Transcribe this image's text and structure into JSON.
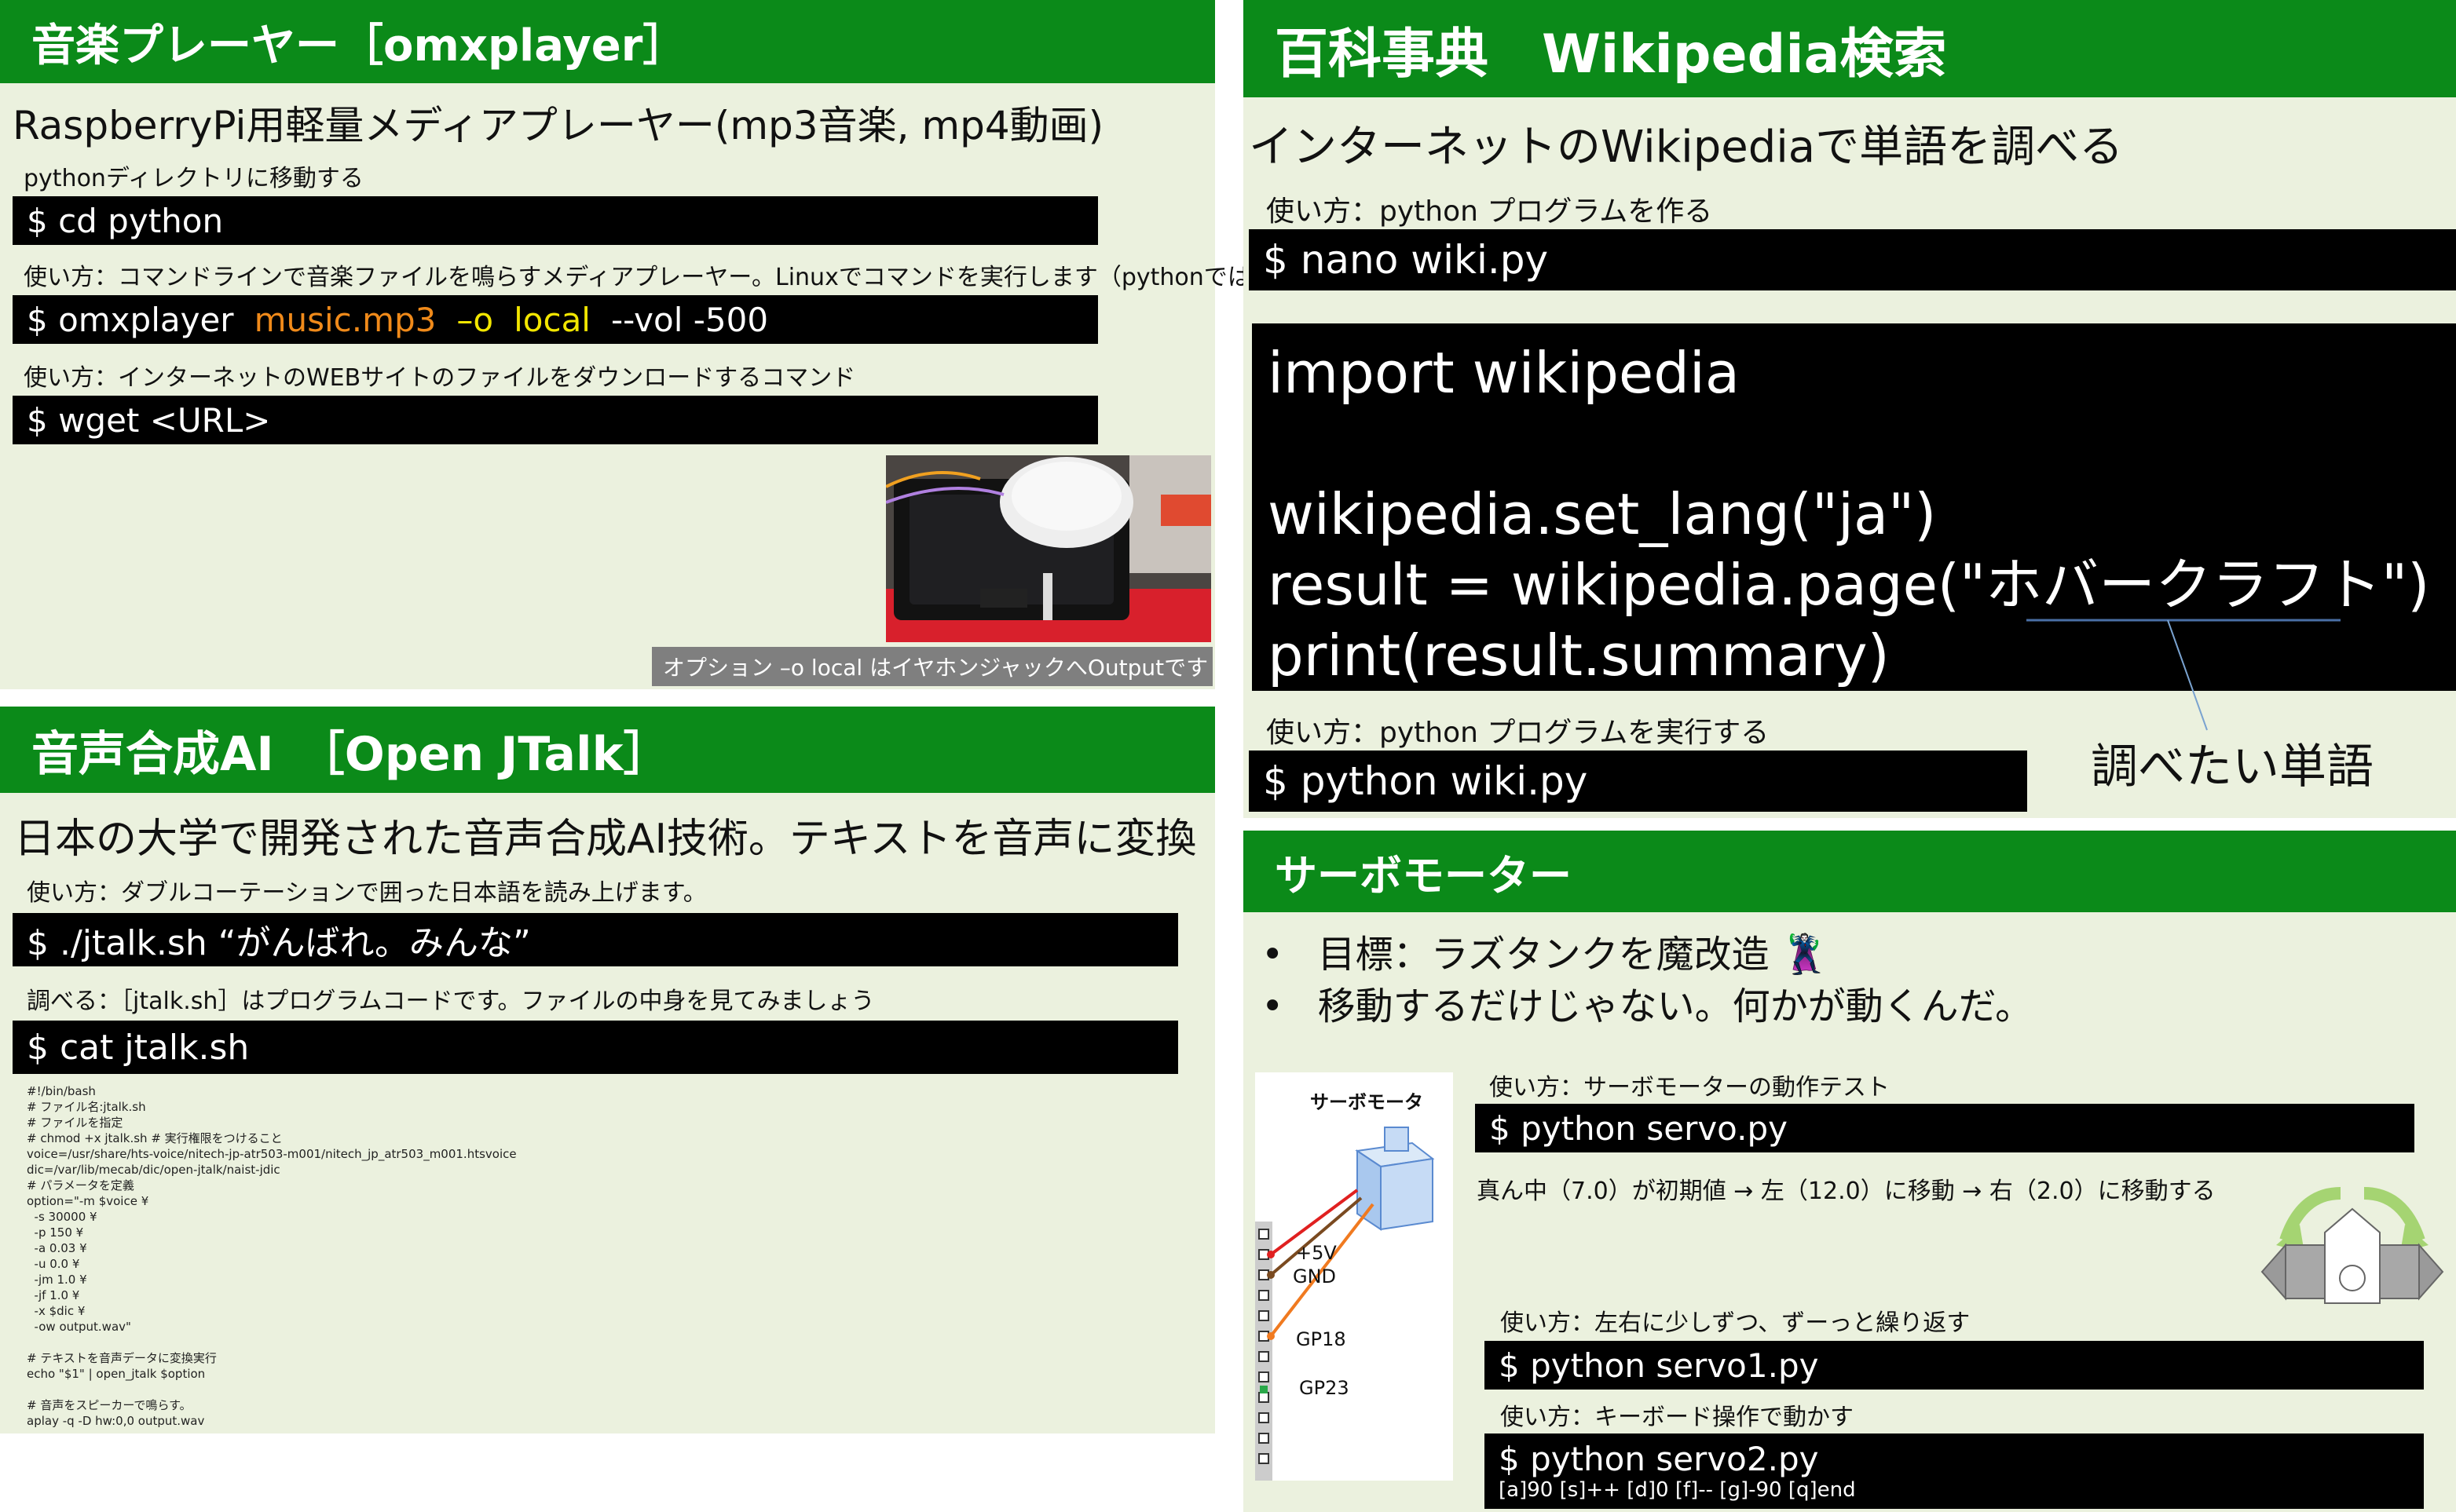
{
  "omx": {
    "title": "音楽プレーヤー［omxplayer］",
    "desc": "RaspberryPi用軽量メディアプレーヤー(mp3音楽, mp4動画)",
    "note1": "pythonディレクトリに移動する",
    "cmd1": "$ cd python",
    "note2": "使い方：コマンドラインで音楽ファイルを鳴らすメディアプレーヤー。Linuxでコマンドを実行します（pythonではない）",
    "cmd2_prefix": "$ omxplayer",
    "cmd2_file": "music.mp3",
    "cmd2_opt": "–o",
    "cmd2_local": "local",
    "cmd2_rest": "--vol  -500",
    "note3": "使い方：インターネットのWEBサイトのファイルをダウンロードするコマンド",
    "cmd3": "$ wget <URL>",
    "option_caption": "オプション –o  local  はイヤホンジャックへOutputです"
  },
  "jtalk": {
    "title": "音声合成AI　［Open JTalk］",
    "desc": "日本の大学で開発された音声合成AI技術。テキストを音声に変換",
    "note1": "使い方：ダブルコーテーションで囲った日本語を読み上げます。",
    "cmd1": "$ ./jtalk.sh  “がんばれ。みんな”",
    "note2": "調べる：［jtalk.sh］はプログラムコードです。ファイルの中身を見てみましょう",
    "cmd2": "$ cat  jtalk.sh",
    "script": "#!/bin/bash\n# ファイル名:jtalk.sh\n# ファイルを指定\n# chmod +x jtalk.sh # 実行権限をつけること\nvoice=/usr/share/hts-voice/nitech-jp-atr503-m001/nitech_jp_atr503_m001.htsvoice\ndic=/var/lib/mecab/dic/open-jtalk/naist-jdic\n# パラメータを定義\noption=\"-m $voice ¥\n  -s 30000 ¥\n  -p 150 ¥\n  -a 0.03 ¥\n  -u 0.0 ¥\n  -jm 1.0 ¥\n  -jf 1.0 ¥\n  -x $dic ¥\n  -ow output.wav\"\n\n# テキストを音声データに変換実行\necho \"$1\" | open_jtalk $option\n\n# 音声をスピーカーで鳴らす。\naplay -q -D hw:0,0 output.wav"
  },
  "wiki": {
    "title": "百科事典　Wikipedia検索",
    "desc": "インターネットのWikipediaで単語を調べる",
    "note1": "使い方：python プログラムを作る",
    "cmd1": "$ nano   wiki.py",
    "code1": "import   wikipedia",
    "code2": "wikipedia.set_lang(\"ja\")",
    "code3": "result  =   wikipedia.page(\"ホバークラフト\")",
    "code4": "print(result.summary)",
    "note2": "使い方：python プログラムを実行する",
    "cmd2": "$ python   wiki.py",
    "callout": "調べたい単語"
  },
  "servo": {
    "title": "サーボモーター",
    "bullet1": "目標：ラズタンクを魔改造 🦹",
    "bullet2": "移動するだけじゃない。何かが動くんだ。",
    "diagram_title": "サーボモータ",
    "pin_5v": "+5V",
    "pin_gnd": "GND",
    "pin_gp18": "GP18",
    "pin_gp23": "GP23",
    "note1": "使い方：サーボモーターの動作テスト",
    "cmd1": "$ python   servo.py",
    "desc1": "真ん中（7.0）が初期値  →  左（12.0）に移動  →  右（2.0）に移動する",
    "note2": "使い方：左右に少しずつ、ずーっと繰り返す",
    "cmd2": "$ python    servo1.py",
    "note3": "使い方：キーボード操作で動かす",
    "cmd3": "$ python    servo2.py",
    "cmd3_keys": "[a]90 [s]++ [d]0 [f]-- [g]-90  [q]end"
  },
  "colors": {
    "header_green": "#0b8a19",
    "panel_bg": "#ebf1de",
    "orange": "#f08a1a",
    "yellow": "#f2e600"
  }
}
